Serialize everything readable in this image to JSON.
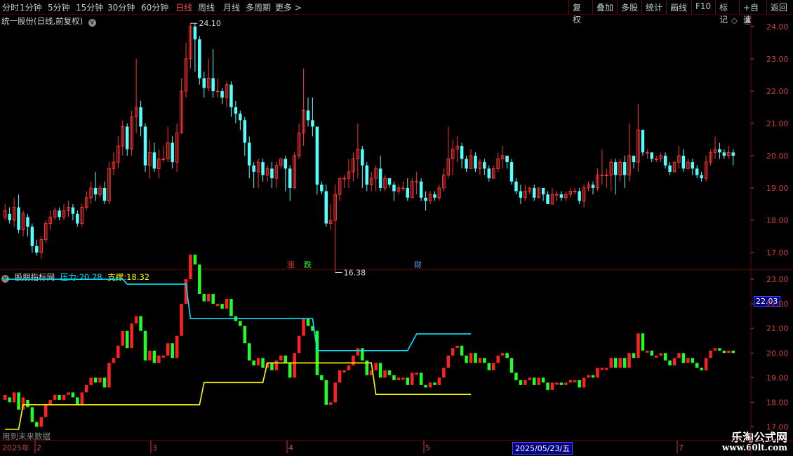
{
  "toolbar": {
    "periods": [
      "分时",
      "1分钟",
      "5分钟",
      "15分钟",
      "30分钟",
      "60分钟",
      "日线",
      "周线",
      "月线",
      "多周期",
      "更多 >"
    ],
    "active_period": "日线",
    "right_buttons": [
      "复权",
      "叠加",
      "多股",
      "统计",
      "画线",
      "F10",
      "标记",
      "+自选",
      "返回"
    ]
  },
  "main_panel": {
    "title": "统一股份(日线,前复权)",
    "high_label": "24.10",
    "low_label": "16.38",
    "badges": [
      {
        "text": "涨",
        "color": "#ff3333"
      },
      {
        "text": "跌",
        "color": "#33ff33"
      },
      {
        "text": "财",
        "color": "#4da6ff"
      }
    ]
  },
  "indicator_panel": {
    "name": "股朋指标网",
    "pressure_label": "压力:",
    "pressure_value": "20.78",
    "support_label": "支撑:",
    "support_value": "18.32",
    "cursor_value": "22.03",
    "footer_note": "用到未来数据"
  },
  "x_axis": {
    "year_label": "2025年",
    "month_labels": [
      "2",
      "3",
      "4",
      "5",
      "7"
    ],
    "cursor_date": "2025/05/23/五"
  },
  "watermark": {
    "line1": "乐淘公式网",
    "line2": "www.60lt.com"
  },
  "colors": {
    "up": "#ff3232",
    "down": "#54ffff",
    "ind_up": "#ff2020",
    "ind_down": "#20ff20",
    "pressure": "#00e5ff",
    "support": "#ffff00",
    "grid": "#5a0000",
    "axis_text": "#c84040"
  },
  "chart_data": [
    {
      "type": "candlestick",
      "title": "统一股份(日线,前复权)",
      "ylim": [
        16.5,
        24.3
      ],
      "y_ticks": [
        "24.00",
        "23.00",
        "22.00",
        "21.00",
        "20.00",
        "19.00",
        "18.00",
        "17.00"
      ],
      "annotations": [
        {
          "text": "24.10",
          "value": 24.1
        },
        {
          "text": "16.38",
          "value": 16.38
        }
      ],
      "candles": [
        [
          18.1,
          18.3,
          18.0,
          18.5
        ],
        [
          18.2,
          18.0,
          17.9,
          18.4
        ],
        [
          18.0,
          18.4,
          17.8,
          18.7
        ],
        [
          18.4,
          17.7,
          17.6,
          18.8
        ],
        [
          17.7,
          18.2,
          17.5,
          18.3
        ],
        [
          18.1,
          17.8,
          17.5,
          18.2
        ],
        [
          17.8,
          17.2,
          17.0,
          17.9
        ],
        [
          17.2,
          17.0,
          16.9,
          17.4
        ],
        [
          17.0,
          17.4,
          16.8,
          17.5
        ],
        [
          17.4,
          17.9,
          17.3,
          18.0
        ],
        [
          17.9,
          18.1,
          17.7,
          18.3
        ],
        [
          18.1,
          18.3,
          18.0,
          18.4
        ],
        [
          18.3,
          18.1,
          18.0,
          18.4
        ],
        [
          18.1,
          18.3,
          18.0,
          18.5
        ],
        [
          18.3,
          18.4,
          18.1,
          18.6
        ],
        [
          18.4,
          18.2,
          18.0,
          18.5
        ],
        [
          18.2,
          17.9,
          17.8,
          18.3
        ],
        [
          17.9,
          18.4,
          17.8,
          18.5
        ],
        [
          18.4,
          18.7,
          18.3,
          18.9
        ],
        [
          18.7,
          19.0,
          18.5,
          19.2
        ],
        [
          19.0,
          18.8,
          18.6,
          19.5
        ],
        [
          18.8,
          19.0,
          18.7,
          19.1
        ],
        [
          19.0,
          18.6,
          18.5,
          19.2
        ],
        [
          18.6,
          19.6,
          18.5,
          19.8
        ],
        [
          19.6,
          19.8,
          19.4,
          20.1
        ],
        [
          19.8,
          20.3,
          19.6,
          20.6
        ],
        [
          20.3,
          20.9,
          20.0,
          21.1
        ],
        [
          20.9,
          20.2,
          20.0,
          21.0
        ],
        [
          20.2,
          21.2,
          20.0,
          21.4
        ],
        [
          21.2,
          21.5,
          20.7,
          23.0
        ],
        [
          21.5,
          20.9,
          20.6,
          21.7
        ],
        [
          20.9,
          19.7,
          19.5,
          21.0
        ],
        [
          19.7,
          20.1,
          19.3,
          20.5
        ],
        [
          20.1,
          19.6,
          19.5,
          20.4
        ],
        [
          19.6,
          19.9,
          19.3,
          20.2
        ],
        [
          19.9,
          19.9,
          19.8,
          20.3
        ],
        [
          19.9,
          20.4,
          19.8,
          20.9
        ],
        [
          20.4,
          19.8,
          19.6,
          20.6
        ],
        [
          19.8,
          20.7,
          19.5,
          21.0
        ],
        [
          20.7,
          22.0,
          20.7,
          22.4
        ],
        [
          22.0,
          23.0,
          21.8,
          23.5
        ],
        [
          23.0,
          24.0,
          22.7,
          24.1
        ],
        [
          24.0,
          23.6,
          22.6,
          24.1
        ],
        [
          23.6,
          22.4,
          22.2,
          23.7
        ],
        [
          22.4,
          22.1,
          21.8,
          22.6
        ],
        [
          22.1,
          22.4,
          22.0,
          23.0
        ],
        [
          22.4,
          22.0,
          21.8,
          23.3
        ],
        [
          22.0,
          22.0,
          21.8,
          22.4
        ],
        [
          22.0,
          21.8,
          21.6,
          22.1
        ],
        [
          21.8,
          22.2,
          21.5,
          22.3
        ],
        [
          22.2,
          21.5,
          21.2,
          22.3
        ],
        [
          21.5,
          21.3,
          21.0,
          21.7
        ],
        [
          21.3,
          21.1,
          20.8,
          21.4
        ],
        [
          21.1,
          20.4,
          20.0,
          21.2
        ],
        [
          20.4,
          19.7,
          19.3,
          20.6
        ],
        [
          19.7,
          19.5,
          19.0,
          19.8
        ],
        [
          19.5,
          19.8,
          19.0,
          19.9
        ],
        [
          19.8,
          19.4,
          19.2,
          19.9
        ],
        [
          19.4,
          19.6,
          19.2,
          19.7
        ],
        [
          19.6,
          19.3,
          19.0,
          19.8
        ],
        [
          19.3,
          19.7,
          19.0,
          19.8
        ],
        [
          19.7,
          19.9,
          19.6,
          19.9
        ],
        [
          19.9,
          19.6,
          18.9,
          20.0
        ],
        [
          19.6,
          19.0,
          18.6,
          19.7
        ],
        [
          19.0,
          20.0,
          19.0,
          20.1
        ],
        [
          20.0,
          20.7,
          19.9,
          21.0
        ],
        [
          20.7,
          21.4,
          20.3,
          22.7
        ],
        [
          21.4,
          21.1,
          20.9,
          21.8
        ],
        [
          21.1,
          20.9,
          20.6,
          21.8
        ],
        [
          20.9,
          19.1,
          18.8,
          20.9
        ],
        [
          19.1,
          18.9,
          18.8,
          19.2
        ],
        [
          18.9,
          17.9,
          17.8,
          19.1
        ],
        [
          17.9,
          18.0,
          17.7,
          18.5
        ],
        [
          18.0,
          18.8,
          16.4,
          19.1
        ],
        [
          18.8,
          19.3,
          18.6,
          19.3
        ],
        [
          19.3,
          19.3,
          19.0,
          19.4
        ],
        [
          19.3,
          19.5,
          19.0,
          19.9
        ],
        [
          19.5,
          19.9,
          19.2,
          20.1
        ],
        [
          19.9,
          20.2,
          19.3,
          21.0
        ],
        [
          20.2,
          19.7,
          19.0,
          20.3
        ],
        [
          19.7,
          19.1,
          18.9,
          19.8
        ],
        [
          19.1,
          19.3,
          18.9,
          19.5
        ],
        [
          19.3,
          19.6,
          18.9,
          19.7
        ],
        [
          19.6,
          19.0,
          18.9,
          20.0
        ],
        [
          19.0,
          19.3,
          18.9,
          19.4
        ],
        [
          19.3,
          19.1,
          19.0,
          19.3
        ],
        [
          19.1,
          18.9,
          18.6,
          19.2
        ],
        [
          18.9,
          19.0,
          18.8,
          19.1
        ],
        [
          19.0,
          19.0,
          18.9,
          19.2
        ],
        [
          19.0,
          18.7,
          18.6,
          19.3
        ],
        [
          18.7,
          19.2,
          18.7,
          19.3
        ],
        [
          19.2,
          19.2,
          18.8,
          19.5
        ],
        [
          19.2,
          18.7,
          18.6,
          19.3
        ],
        [
          18.7,
          18.6,
          18.3,
          18.9
        ],
        [
          18.6,
          18.8,
          18.5,
          18.9
        ],
        [
          18.8,
          18.7,
          18.6,
          18.9
        ],
        [
          18.7,
          19.0,
          18.6,
          19.1
        ],
        [
          19.0,
          19.4,
          18.9,
          19.6
        ],
        [
          19.4,
          19.9,
          19.3,
          20.9
        ],
        [
          19.9,
          20.2,
          19.4,
          20.5
        ],
        [
          20.2,
          20.3,
          19.8,
          20.6
        ],
        [
          20.3,
          19.9,
          19.6,
          20.4
        ],
        [
          19.9,
          19.6,
          19.5,
          20.0
        ],
        [
          19.6,
          20.0,
          19.6,
          20.2
        ],
        [
          20.0,
          19.6,
          19.5,
          20.1
        ],
        [
          19.6,
          19.8,
          19.4,
          19.9
        ],
        [
          19.8,
          19.6,
          19.4,
          19.9
        ],
        [
          19.6,
          19.3,
          19.2,
          19.7
        ],
        [
          19.3,
          19.6,
          19.3,
          19.7
        ],
        [
          19.6,
          19.9,
          19.5,
          20.1
        ],
        [
          19.9,
          20.0,
          19.6,
          20.3
        ],
        [
          20.0,
          19.8,
          19.6,
          20.0
        ],
        [
          19.8,
          19.2,
          19.1,
          19.9
        ],
        [
          19.2,
          18.9,
          18.8,
          19.3
        ],
        [
          18.9,
          18.7,
          18.5,
          19.1
        ],
        [
          18.7,
          18.9,
          18.6,
          19.1
        ],
        [
          18.9,
          19.0,
          18.8,
          19.0
        ],
        [
          19.0,
          18.7,
          18.6,
          19.1
        ],
        [
          18.7,
          19.0,
          18.7,
          19.0
        ],
        [
          19.0,
          18.8,
          18.6,
          18.9
        ],
        [
          18.8,
          18.5,
          18.5,
          18.9
        ],
        [
          18.5,
          18.8,
          18.5,
          19.0
        ],
        [
          18.8,
          18.8,
          18.6,
          18.9
        ],
        [
          18.8,
          18.7,
          18.6,
          18.9
        ],
        [
          18.7,
          18.8,
          18.6,
          18.9
        ],
        [
          18.8,
          18.9,
          18.7,
          19.0
        ],
        [
          18.9,
          18.9,
          18.8,
          19.0
        ],
        [
          18.9,
          18.6,
          18.5,
          19.0
        ],
        [
          18.6,
          19.0,
          18.4,
          19.1
        ],
        [
          19.0,
          19.1,
          18.9,
          19.2
        ],
        [
          19.1,
          19.0,
          18.8,
          19.2
        ],
        [
          19.0,
          19.4,
          18.9,
          19.6
        ],
        [
          19.4,
          19.4,
          19.1,
          20.2
        ],
        [
          19.4,
          19.4,
          19.0,
          19.6
        ],
        [
          19.4,
          19.8,
          18.9,
          19.9
        ],
        [
          19.8,
          19.4,
          18.8,
          19.9
        ],
        [
          19.4,
          19.8,
          19.2,
          19.9
        ],
        [
          19.8,
          19.4,
          19.0,
          20.0
        ],
        [
          19.4,
          20.0,
          19.2,
          21.0
        ],
        [
          20.0,
          19.8,
          19.6,
          20.0
        ],
        [
          19.8,
          20.8,
          19.5,
          21.6
        ],
        [
          20.8,
          20.1,
          20.0,
          20.8
        ],
        [
          20.1,
          20.1,
          19.9,
          20.2
        ],
        [
          20.1,
          19.9,
          19.8,
          20.1
        ],
        [
          19.9,
          19.9,
          19.8,
          20.0
        ],
        [
          19.9,
          20.0,
          19.8,
          20.1
        ],
        [
          20.0,
          19.7,
          19.6,
          20.1
        ],
        [
          19.7,
          19.5,
          19.4,
          19.8
        ],
        [
          19.5,
          19.8,
          19.5,
          19.8
        ],
        [
          19.8,
          20.0,
          19.6,
          20.3
        ],
        [
          20.0,
          19.6,
          19.5,
          20.2
        ],
        [
          19.6,
          19.8,
          19.6,
          19.9
        ],
        [
          19.8,
          19.6,
          19.4,
          19.9
        ],
        [
          19.6,
          19.4,
          19.3,
          19.7
        ],
        [
          19.4,
          19.3,
          19.2,
          19.5
        ],
        [
          19.3,
          19.8,
          19.2,
          20.0
        ],
        [
          19.8,
          20.1,
          19.7,
          20.2
        ],
        [
          20.1,
          20.2,
          19.9,
          20.6
        ],
        [
          20.2,
          20.1,
          19.9,
          20.4
        ],
        [
          20.1,
          20.0,
          19.9,
          20.2
        ],
        [
          20.0,
          20.1,
          19.9,
          20.3
        ],
        [
          20.1,
          20.0,
          19.7,
          20.2
        ]
      ]
    },
    {
      "type": "bar",
      "title": "股朋指标网",
      "ylim": [
        16.9,
        23.4
      ],
      "y_ticks": [
        "23.00",
        "22.00",
        "21.00",
        "20.00",
        "19.00",
        "18.00",
        "17.00"
      ],
      "bars_ref": "main candles (open/close)",
      "series": [
        {
          "name": "压力",
          "type": "line",
          "points": [
            [
              0,
              23.0
            ],
            [
              26,
              23.0
            ],
            [
              27,
              22.8
            ],
            [
              40,
              22.8
            ],
            [
              41,
              21.4
            ],
            [
              68,
              21.4
            ],
            [
              69,
              20.1
            ],
            [
              89,
              20.1
            ],
            [
              91,
              20.78
            ],
            [
              103,
              20.78
            ]
          ]
        },
        {
          "name": "支撑",
          "type": "line",
          "points": [
            [
              0,
              16.9
            ],
            [
              3,
              16.9
            ],
            [
              4,
              17.9
            ],
            [
              43,
              17.9
            ],
            [
              44,
              18.8
            ],
            [
              57,
              18.8
            ],
            [
              58,
              19.6
            ],
            [
              81,
              19.6
            ],
            [
              82,
              18.32
            ],
            [
              103,
              18.32
            ]
          ]
        }
      ]
    }
  ]
}
